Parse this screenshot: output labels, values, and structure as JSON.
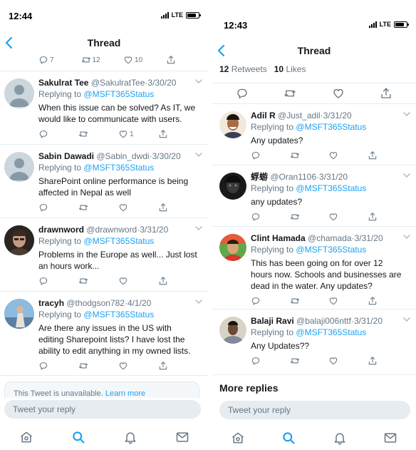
{
  "colors": {
    "accent": "#1da1f2",
    "secondary_text": "#657786",
    "divider": "#e6ecf0"
  },
  "left": {
    "status": {
      "time": "12:44",
      "carrier": "LTE"
    },
    "nav": {
      "title": "Thread",
      "back_icon": "chevron-left-icon"
    },
    "top_actions": {
      "reply_count": "7",
      "retweet_count": "12",
      "like_count": "10"
    },
    "tweets": [
      {
        "name": "Sakulrat Tee",
        "handle": "@SakulratTee",
        "dot": "·",
        "date": "3/30/20",
        "replying_prefix": "Replying to",
        "mention": "@MSFT365Status",
        "text": "When this issue can be solved? As IT, we would like to communicate with users.",
        "reply_count": "",
        "retweet_count": "",
        "like_count": "1"
      },
      {
        "name": "Sabin Dawadi",
        "handle": "@Sabin_dwdi",
        "dot": "·",
        "date": "3/30/20",
        "replying_prefix": "Replying to",
        "mention": "@MSFT365Status",
        "text": "SharePoint online performance is being affected in Nepal as well",
        "reply_count": "",
        "retweet_count": "",
        "like_count": ""
      },
      {
        "name": "drawnword",
        "handle": "@drawnword",
        "dot": "·",
        "date": "3/31/20",
        "replying_prefix": "Replying to",
        "mention": "@MSFT365Status",
        "text": "Problems in the Europe as well... Just lost an hours work...",
        "reply_count": "",
        "retweet_count": "",
        "like_count": ""
      },
      {
        "name": "tracyh",
        "handle": "@thodgson782",
        "dot": "·",
        "date": "4/1/20",
        "replying_prefix": "Replying to",
        "mention": "@MSFT365Status",
        "text": "Are there any issues in the US with editing Sharepoint lists? I have lost the ability to edit anything in my owned lists.",
        "reply_count": "",
        "retweet_count": "",
        "like_count": ""
      }
    ],
    "unavailable": {
      "text": "This Tweet is unavailable.",
      "link": "Learn more"
    },
    "reply_placeholder": "Tweet your reply"
  },
  "right": {
    "status": {
      "time": "12:43",
      "carrier": "LTE"
    },
    "nav": {
      "title": "Thread",
      "back_icon": "chevron-left-icon"
    },
    "stats": {
      "retweets_count": "12",
      "retweets_label": "Retweets",
      "likes_count": "10",
      "likes_label": "Likes"
    },
    "tweets": [
      {
        "name": "Adil R",
        "handle": "@Just_adil",
        "dot": "·",
        "date": "3/31/20",
        "replying_prefix": "Replying to",
        "mention": "@MSFT365Status",
        "text": "Any updates?"
      },
      {
        "name": "蜉蝣",
        "handle": "@Oran1106",
        "dot": "·",
        "date": "3/31/20",
        "replying_prefix": "Replying to",
        "mention": "@MSFT365Status",
        "text": "any updates?"
      },
      {
        "name": "Clint Hamada",
        "handle": "@chamada",
        "dot": "·",
        "date": "3/31/20",
        "replying_prefix": "Replying to",
        "mention": "@MSFT365Status",
        "text": "This has been going on for over 12 hours now. Schools and businesses are dead in the water. Any updates?"
      },
      {
        "name": "Balaji Ravi",
        "handle": "@balaji006nttf",
        "dot": "·",
        "date": "3/31/20",
        "replying_prefix": "Replying to",
        "mention": "@MSFT365Status",
        "text": "Any Updates??"
      }
    ],
    "more_replies": "More replies",
    "reply_placeholder": "Tweet your reply"
  },
  "tab_icons": [
    "home-icon",
    "search-icon",
    "notifications-icon",
    "messages-icon"
  ]
}
